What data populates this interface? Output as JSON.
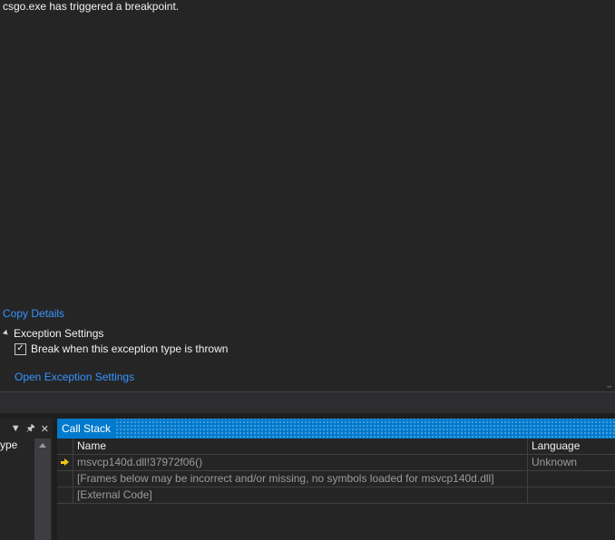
{
  "exception": {
    "message": "csgo.exe has triggered a breakpoint.",
    "copy_details_label": "Copy Details",
    "settings_header": "Exception Settings",
    "break_checkbox_label": "Break when this exception type is thrown",
    "break_checked": true,
    "open_settings_label": "Open Exception Settings"
  },
  "left_pane": {
    "column_header": "ype",
    "icons": [
      "dropdown-icon",
      "pin-icon",
      "close-icon"
    ]
  },
  "call_stack": {
    "title": "Call Stack",
    "columns": [
      "Name",
      "Language"
    ],
    "rows": [
      {
        "current": true,
        "name": "msvcp140d.dll!37972f06()",
        "language": "Unknown"
      },
      {
        "current": false,
        "name": "[Frames below may be incorrect and/or missing, no symbols loaded for msvcp140d.dll]",
        "language": ""
      },
      {
        "current": false,
        "name": "[External Code]",
        "language": ""
      }
    ]
  },
  "colors": {
    "background": "#252526",
    "link": "#3794ff",
    "accent": "#007acc",
    "current_frame_arrow": "#f5c518"
  }
}
